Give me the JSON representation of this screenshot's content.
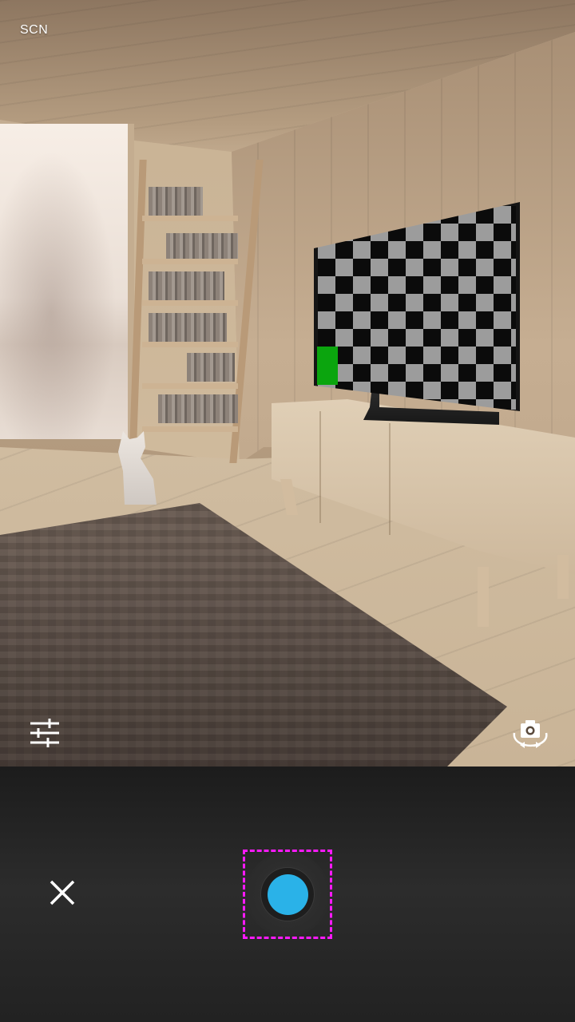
{
  "viewfinder": {
    "mode_label": "SCN"
  },
  "icons": {
    "settings": "sliders-icon",
    "switch_camera": "camera-rotate-icon",
    "close": "close-icon"
  },
  "colors": {
    "shutter_dot": "#2ab2e8",
    "control_bar": "#2a2a2a",
    "focus_outline": "#ff1aff"
  }
}
